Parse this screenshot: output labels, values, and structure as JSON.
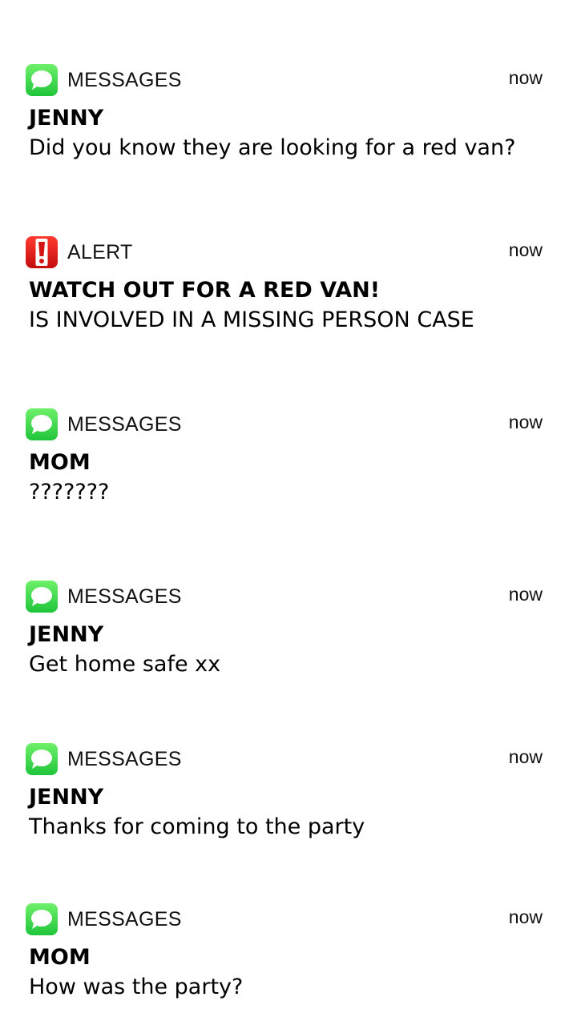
{
  "notifications": [
    {
      "app": "MESSAGES",
      "icon": "messages-icon",
      "time": "now",
      "sender": "JENNY",
      "body": "Did you know they are looking for a red van?"
    },
    {
      "app": "ALERT",
      "icon": "alert-icon",
      "time": "now",
      "sender": "WATCH OUT FOR A RED VAN!",
      "body": "IS INVOLVED IN A MISSING PERSON CASE"
    },
    {
      "app": "MESSAGES",
      "icon": "messages-icon",
      "time": "now",
      "sender": "MOM",
      "body": "???????"
    },
    {
      "app": "MESSAGES",
      "icon": "messages-icon",
      "time": "now",
      "sender": "JENNY",
      "body": "Get home safe xx"
    },
    {
      "app": "MESSAGES",
      "icon": "messages-icon",
      "time": "now",
      "sender": "JENNY",
      "body": "Thanks for coming to the party"
    },
    {
      "app": "MESSAGES",
      "icon": "messages-icon",
      "time": "now",
      "sender": "MOM",
      "body": "How was the party?"
    }
  ],
  "colors": {
    "messages_icon": "#2bd24a",
    "alert_icon": "#e01b1b",
    "text": "#000000",
    "background": "#ffffff"
  }
}
